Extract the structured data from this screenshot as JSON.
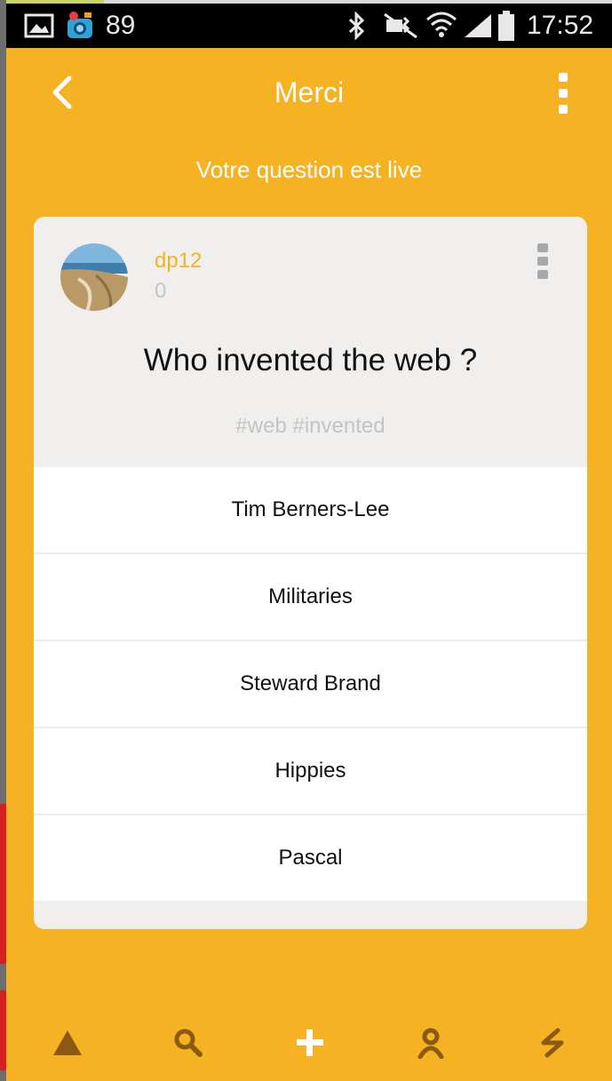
{
  "status_bar": {
    "notification_count": "89",
    "time": "17:52"
  },
  "app_bar": {
    "title": "Merci"
  },
  "subtitle": "Votre question est live",
  "card": {
    "username": "dp12",
    "score": "0",
    "question": "Who invented the web ?",
    "tags": "#web #invented",
    "answers": [
      "Tim Berners-Lee",
      "Militaries",
      "Steward Brand",
      "Hippies",
      "Pascal"
    ]
  },
  "bottom_nav": [
    {
      "icon": "triangle-icon",
      "active": false
    },
    {
      "icon": "search-icon",
      "active": false
    },
    {
      "icon": "plus-icon",
      "active": true
    },
    {
      "icon": "profile-icon",
      "active": false
    },
    {
      "icon": "lightning-icon",
      "active": false
    }
  ],
  "colors": {
    "primary": "#f5b223",
    "nav_icon": "#8a5a12",
    "card_bg": "#f0efed",
    "tag_gray": "#c4c4c4"
  }
}
